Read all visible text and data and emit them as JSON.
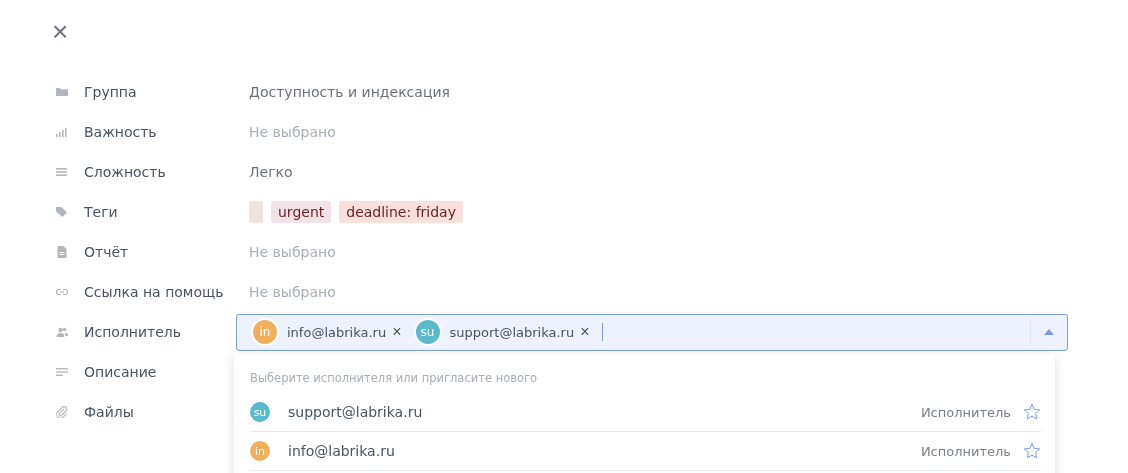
{
  "close": {
    "symbol": "×"
  },
  "fields": [
    {
      "label": "Группа",
      "kind": "text",
      "value": "Доступность и индексация",
      "empty": false
    },
    {
      "label": "Важность",
      "kind": "text",
      "value": "Не выбрано",
      "empty": true
    },
    {
      "label": "Сложность",
      "kind": "text",
      "value": "Легко",
      "empty": false
    },
    {
      "label": "Теги",
      "kind": "tags",
      "tags": [
        {
          "color": "#efe1dc"
        },
        {
          "label": "urgent",
          "color": "#f3e3e8"
        },
        {
          "label": "deadline: friday",
          "color": "#f9e0dc"
        }
      ]
    },
    {
      "label": "Отчёт",
      "kind": "text",
      "value": "Не выбрано",
      "empty": true
    },
    {
      "label": "Ссылка на помощь",
      "kind": "text",
      "value": "Не выбрано",
      "empty": true
    },
    {
      "label": "Исполнитель",
      "kind": "assignee",
      "expanded": true,
      "chips": [
        {
          "initials": "in",
          "color": "#eeb05e",
          "email": "info@labrika.ru",
          "remove": "×"
        },
        {
          "initials": "su",
          "color": "#5bb9cc",
          "email": "support@labrika.ru",
          "remove": "×"
        }
      ]
    },
    {
      "label": "Описание",
      "kind": "empty"
    },
    {
      "label": "Файлы",
      "kind": "empty"
    }
  ],
  "dropdown": {
    "hint": "Выберите исполнителя или пригласите нового",
    "options": [
      {
        "initials": "su",
        "color": "#5bb9cc",
        "email": "support@labrika.ru",
        "role": "Исполнитель",
        "starred": false
      },
      {
        "initials": "in",
        "color": "#eeb05e",
        "email": "info@labrika.ru",
        "role": "Исполнитель",
        "starred": false
      }
    ]
  }
}
